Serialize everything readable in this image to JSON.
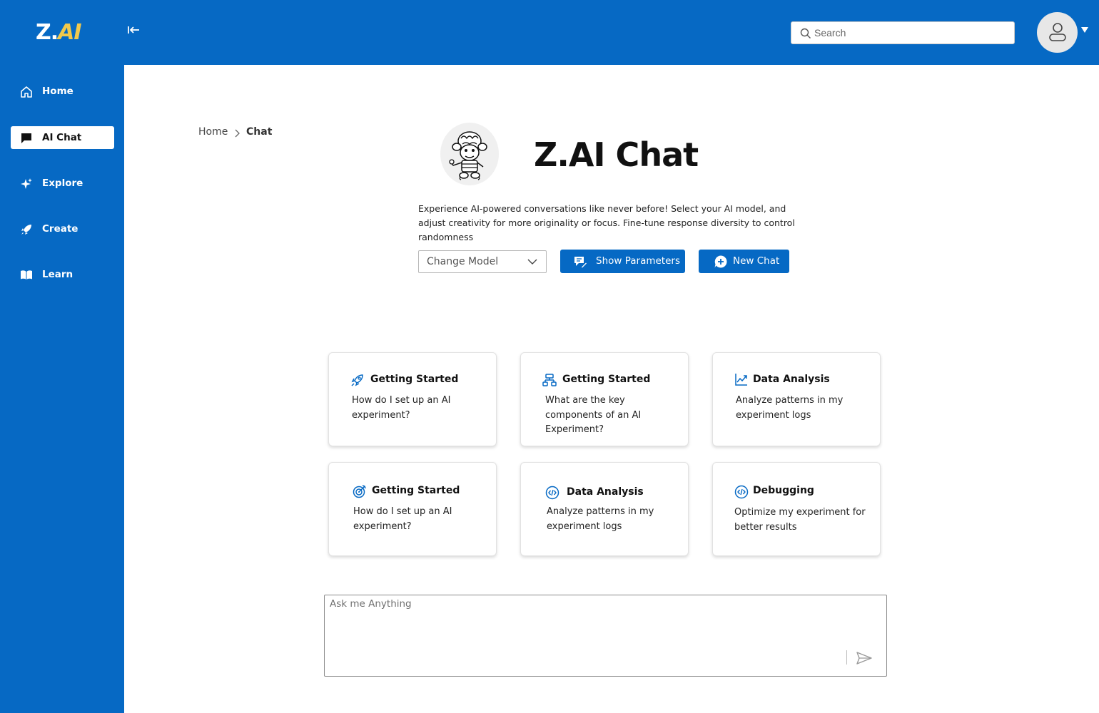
{
  "app": {
    "logo_main": "Z.",
    "logo_accent": "AI"
  },
  "header": {
    "search_placeholder": "Search"
  },
  "sidebar": {
    "items": [
      {
        "label": "Home",
        "icon": "home-icon"
      },
      {
        "label": "AI Chat",
        "icon": "chat-icon",
        "active": true
      },
      {
        "label": "Explore",
        "icon": "sparkle-icon"
      },
      {
        "label": "Create",
        "icon": "rocket-icon"
      },
      {
        "label": "Learn",
        "icon": "book-icon"
      }
    ]
  },
  "breadcrumb": {
    "home": "Home",
    "current": "Chat"
  },
  "hero": {
    "title": "Z.AI Chat",
    "description": "Experience AI-powered conversations like never before! Select your AI model, and adjust creativity for more originality or focus. Fine-tune response diversity to control randomness"
  },
  "controls": {
    "model_select_label": "Change Model",
    "show_parameters_label": "Show Parameters",
    "new_chat_label": "New Chat"
  },
  "cards": [
    {
      "title": "Getting Started",
      "body": "How do I set up an AI experiment?",
      "icon": "rocket-icon"
    },
    {
      "title": "Getting Started",
      "body": "What are the key components of an AI Experiment?",
      "icon": "hierarchy-icon"
    },
    {
      "title": "Data Analysis",
      "body": "Analyze patterns in my experiment logs",
      "icon": "trend-chart-icon"
    },
    {
      "title": "Getting Started",
      "body": "How do I set up an AI experiment?",
      "icon": "target-icon"
    },
    {
      "title": "Data Analysis",
      "body": "Analyze patterns in my experiment logs",
      "icon": "code-icon"
    },
    {
      "title": "Debugging",
      "body": "Optimize my experiment for better results",
      "icon": "code-icon"
    }
  ],
  "chat_input": {
    "placeholder": "Ask me Anything"
  },
  "colors": {
    "brand_blue": "#0669c4",
    "logo_accent": "#f2c94c",
    "background": "#ffffff"
  }
}
